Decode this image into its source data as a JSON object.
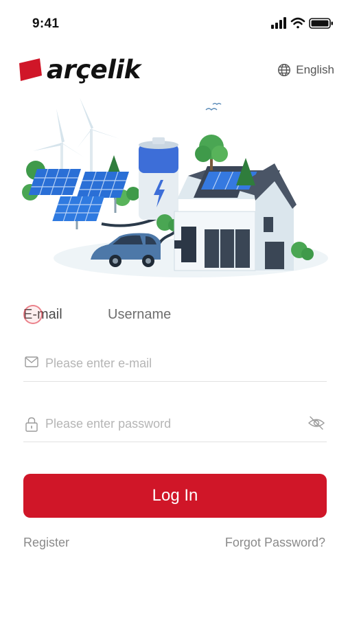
{
  "status_bar": {
    "time": "9:41"
  },
  "brand": {
    "name": "arçelik",
    "color": "#d01628"
  },
  "language": {
    "label": "English",
    "icon": "globe-icon"
  },
  "login_tabs": [
    {
      "label": "E-mail",
      "active": true
    },
    {
      "label": "Username",
      "active": false
    }
  ],
  "form": {
    "email": {
      "value": "",
      "placeholder": "Please enter e-mail",
      "icon": "mail-icon"
    },
    "password": {
      "value": "",
      "placeholder": "Please enter password",
      "icon": "lock-icon",
      "toggle_icon": "eye-off-icon"
    }
  },
  "actions": {
    "login_label": "Log In",
    "register_label": "Register",
    "forgot_label": "Forgot Password?"
  },
  "colors": {
    "accent": "#d01628",
    "text": "#333333",
    "placeholder": "#b5b5b5",
    "divider": "#e2e2e2"
  }
}
